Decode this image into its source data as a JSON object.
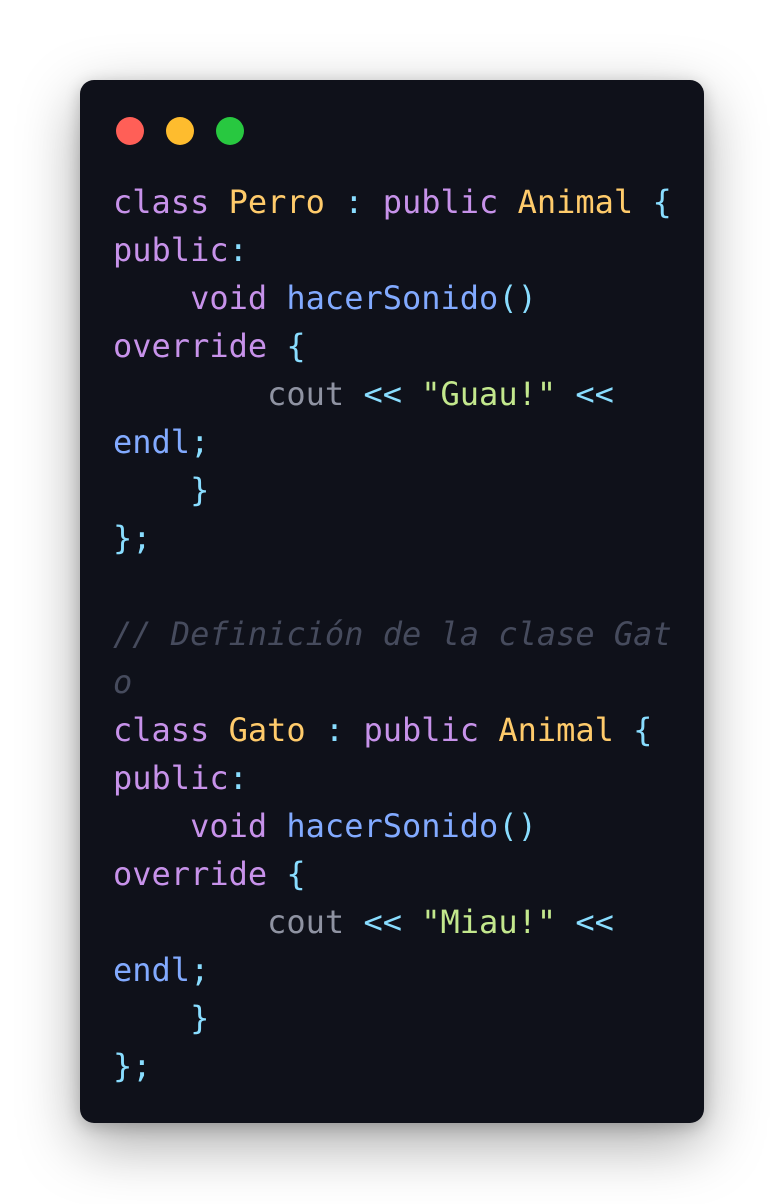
{
  "window": {
    "controls": [
      {
        "name": "close",
        "color": "#ff5f57"
      },
      {
        "name": "minimize",
        "color": "#febc2e"
      },
      {
        "name": "maximize",
        "color": "#28c840"
      }
    ]
  },
  "code": {
    "language": "C++",
    "lines": [
      [
        {
          "t": "class",
          "c": "kw"
        },
        {
          "t": " "
        },
        {
          "t": "Perro",
          "c": "ty"
        },
        {
          "t": " "
        },
        {
          "t": ":",
          "c": "pn"
        },
        {
          "t": " "
        },
        {
          "t": "public",
          "c": "kw"
        },
        {
          "t": " "
        },
        {
          "t": "Animal",
          "c": "ty"
        },
        {
          "t": " "
        },
        {
          "t": "{",
          "c": "pn"
        }
      ],
      [
        {
          "t": "public",
          "c": "kw"
        },
        {
          "t": ":",
          "c": "pn"
        }
      ],
      [
        {
          "t": "    "
        },
        {
          "t": "void",
          "c": "kw"
        },
        {
          "t": " "
        },
        {
          "t": "hacerSonido",
          "c": "fn"
        },
        {
          "t": "()",
          "c": "pn"
        }
      ],
      [
        {
          "t": "override",
          "c": "kw"
        },
        {
          "t": " "
        },
        {
          "t": "{",
          "c": "pn"
        }
      ],
      [
        {
          "t": "        "
        },
        {
          "t": "cout",
          "c": "id"
        },
        {
          "t": " "
        },
        {
          "t": "<<",
          "c": "pn"
        },
        {
          "t": " "
        },
        {
          "t": "\"Guau!\"",
          "c": "str"
        },
        {
          "t": " "
        },
        {
          "t": "<<",
          "c": "pn"
        }
      ],
      [
        {
          "t": "endl",
          "c": "fn"
        },
        {
          "t": ";",
          "c": "pn"
        }
      ],
      [
        {
          "t": "    "
        },
        {
          "t": "}",
          "c": "pn"
        }
      ],
      [
        {
          "t": "};",
          "c": "pn"
        }
      ],
      [],
      [
        {
          "t": "// Definición de la clase Gat",
          "c": "cm"
        }
      ],
      [
        {
          "t": "o",
          "c": "cm"
        }
      ],
      [
        {
          "t": "class",
          "c": "kw"
        },
        {
          "t": " "
        },
        {
          "t": "Gato",
          "c": "ty"
        },
        {
          "t": " "
        },
        {
          "t": ":",
          "c": "pn"
        },
        {
          "t": " "
        },
        {
          "t": "public",
          "c": "kw"
        },
        {
          "t": " "
        },
        {
          "t": "Animal",
          "c": "ty"
        },
        {
          "t": " "
        },
        {
          "t": "{",
          "c": "pn"
        }
      ],
      [
        {
          "t": "public",
          "c": "kw"
        },
        {
          "t": ":",
          "c": "pn"
        }
      ],
      [
        {
          "t": "    "
        },
        {
          "t": "void",
          "c": "kw"
        },
        {
          "t": " "
        },
        {
          "t": "hacerSonido",
          "c": "fn"
        },
        {
          "t": "()",
          "c": "pn"
        }
      ],
      [
        {
          "t": "override",
          "c": "kw"
        },
        {
          "t": " "
        },
        {
          "t": "{",
          "c": "pn"
        }
      ],
      [
        {
          "t": "        "
        },
        {
          "t": "cout",
          "c": "id"
        },
        {
          "t": " "
        },
        {
          "t": "<<",
          "c": "pn"
        },
        {
          "t": " "
        },
        {
          "t": "\"Miau!\"",
          "c": "str"
        },
        {
          "t": " "
        },
        {
          "t": "<<",
          "c": "pn"
        }
      ],
      [
        {
          "t": "endl",
          "c": "fn"
        },
        {
          "t": ";",
          "c": "pn"
        }
      ],
      [
        {
          "t": "    "
        },
        {
          "t": "}",
          "c": "pn"
        }
      ],
      [
        {
          "t": "};",
          "c": "pn"
        }
      ]
    ]
  },
  "colors": {
    "background": "#0f111a",
    "keyword": "#c792ea",
    "type": "#ffcb6b",
    "punctuation": "#89ddff",
    "function": "#82aaff",
    "identifier": "#8f93a2",
    "string": "#c3e88d",
    "comment": "#464b5d"
  }
}
